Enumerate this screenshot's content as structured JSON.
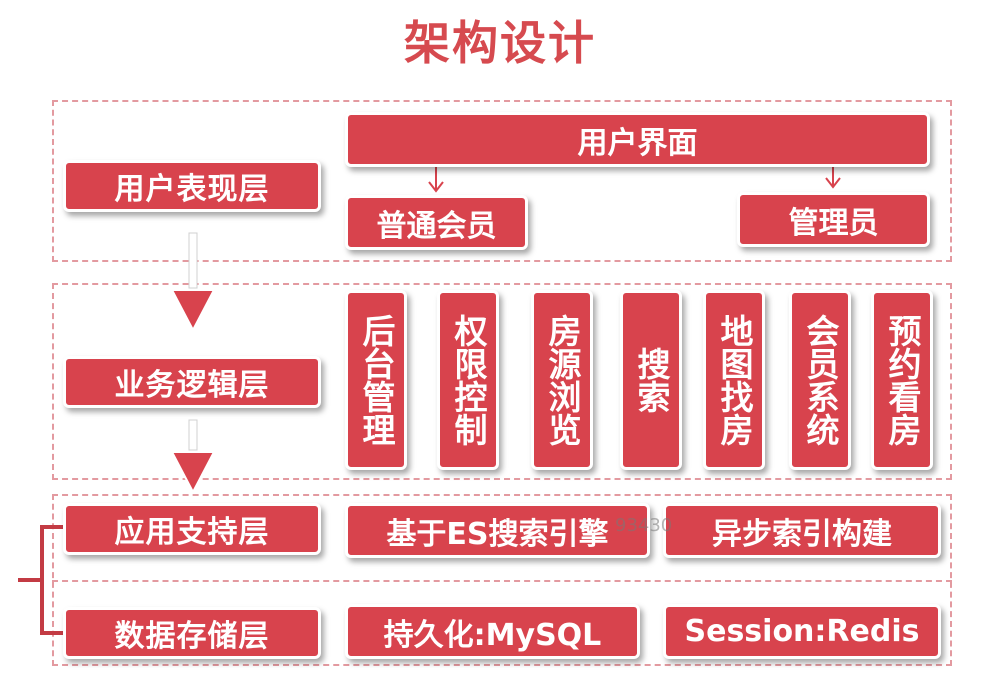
{
  "title": "架构设计",
  "layers": {
    "presentation": "用户表现层",
    "business": "业务逻辑层",
    "application": "应用支持层",
    "data": "数据存储层"
  },
  "presentation": {
    "user_interface": "用户界面",
    "member": "普通会员",
    "admin": "管理员"
  },
  "business_modules": [
    {
      "label": "后台管理"
    },
    {
      "label": "权限控制"
    },
    {
      "label": "房源浏览"
    },
    {
      "label": "搜索"
    },
    {
      "label": "地图找房"
    },
    {
      "label": "会员系统"
    },
    {
      "label": "预约看房"
    }
  ],
  "application": {
    "es": "基于ES搜索引擎",
    "async": "异步索引构建"
  },
  "data": {
    "mysql": "持久化:MySQL",
    "redis": "Session:Redis"
  },
  "watermark": "93430",
  "colors": {
    "box": "#d8434d",
    "dash": "#e39aa0",
    "title": "#d64a4f"
  }
}
